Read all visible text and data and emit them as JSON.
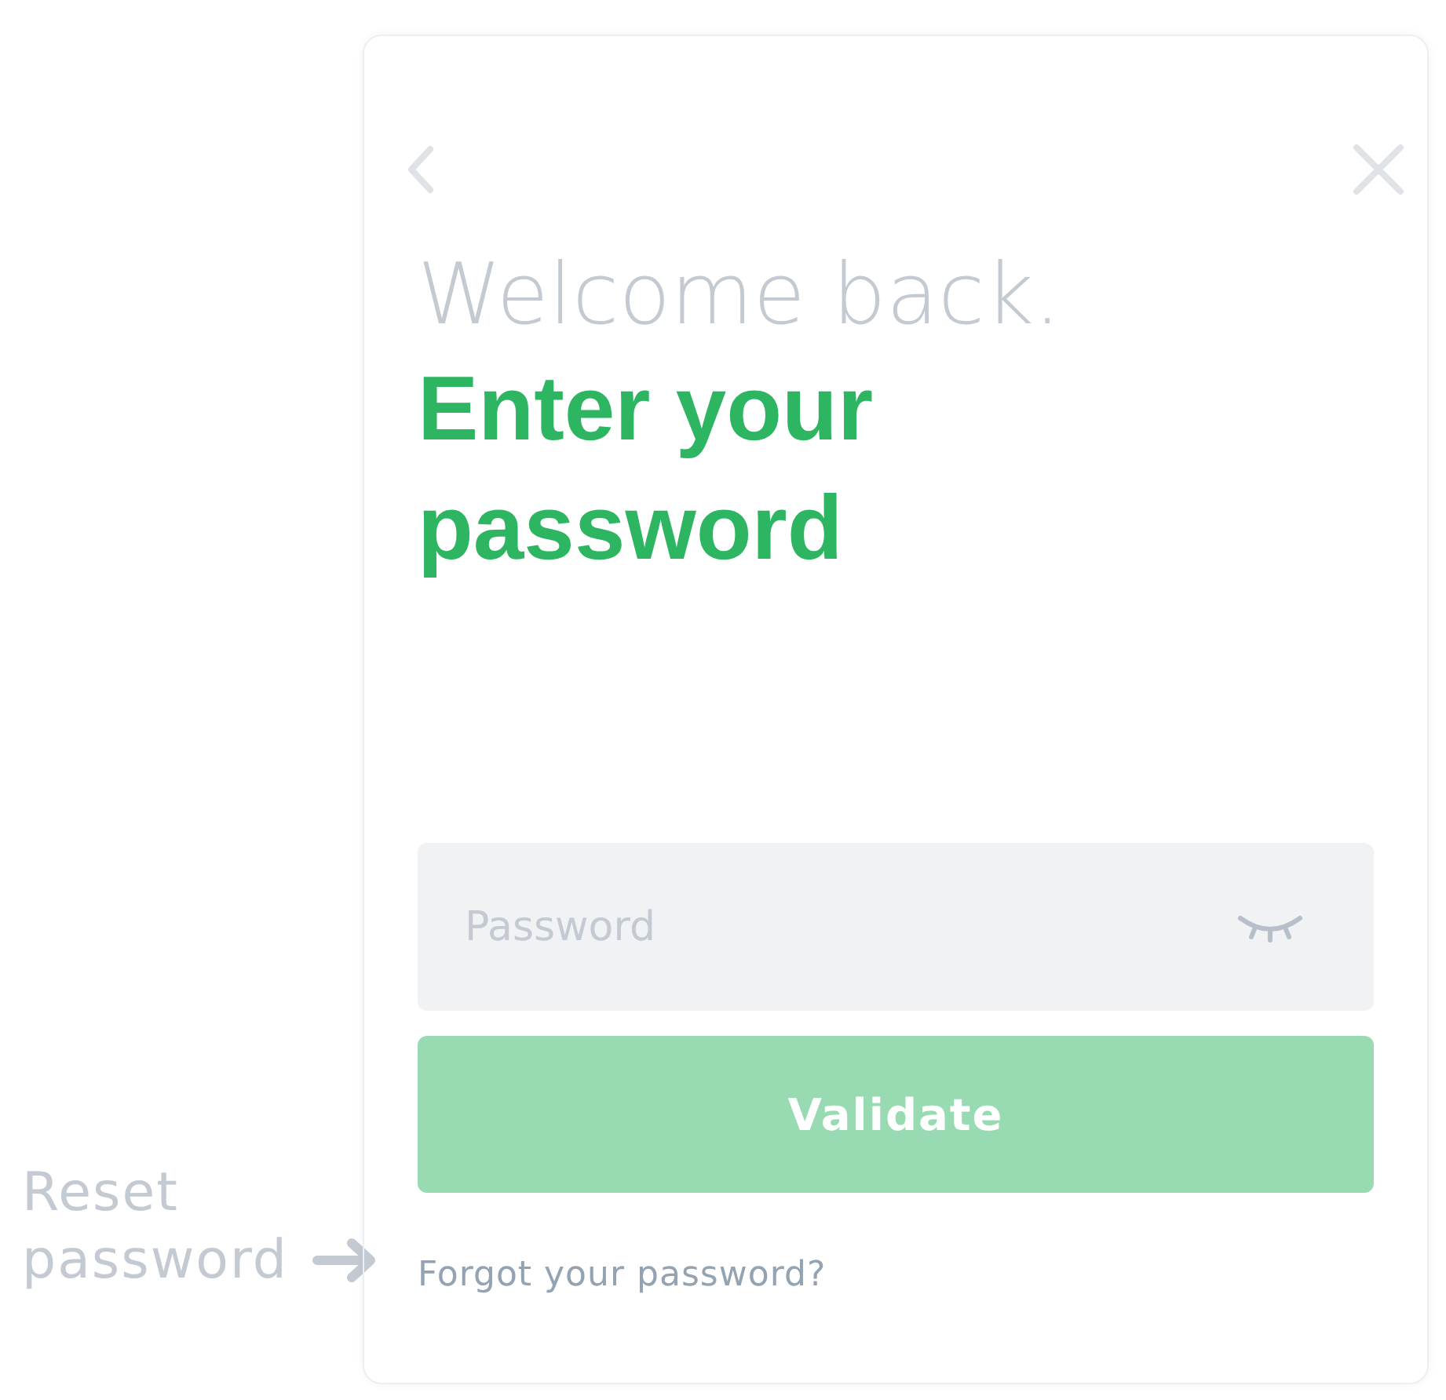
{
  "heading": {
    "greeting": "Welcome back.",
    "title": "Enter your password"
  },
  "password_field": {
    "placeholder": "Password",
    "visible": false
  },
  "validate_button": {
    "label": "Validate",
    "disabled": true
  },
  "forgot_link": "Forgot your password?",
  "annotation": {
    "label": "Reset password"
  }
}
